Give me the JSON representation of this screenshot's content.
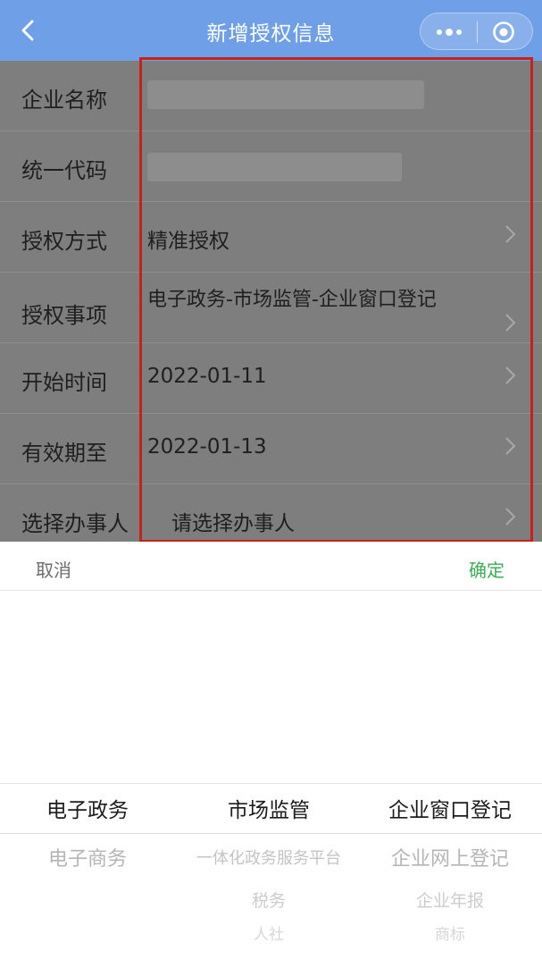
{
  "header": {
    "title": "新增授权信息",
    "back_icon": "chevron-left-icon",
    "more_icon": "more-dots-icon",
    "close_icon": "target-circle-icon"
  },
  "form": {
    "rows": [
      {
        "label": "企业名称",
        "value": ""
      },
      {
        "label": "统一代码",
        "value": ""
      },
      {
        "label": "授权方式",
        "value": "精准授权"
      },
      {
        "label": "授权事项",
        "value": "电子政务-市场监管-企业窗口登记"
      },
      {
        "label": "开始时间",
        "value": "2022-01-11"
      },
      {
        "label": "有效期至",
        "value": "2022-01-13"
      },
      {
        "label": "选择办事人",
        "value": "请选择办事人"
      }
    ]
  },
  "picker": {
    "cancel_label": "取消",
    "confirm_label": "确定",
    "columns": [
      {
        "selected": "电子政务",
        "below": [
          "电子商务"
        ]
      },
      {
        "selected": "市场监管",
        "below": [
          "一体化政务服务平台",
          "税务",
          "人社"
        ]
      },
      {
        "selected": "企业窗口登记",
        "below": [
          "企业网上登记",
          "企业年报",
          "商标"
        ]
      }
    ]
  },
  "colors": {
    "title_bar": "#6f9fe6",
    "overlay": "#7e7e7e",
    "highlight_border": "#c8201c",
    "confirm": "#3cad54"
  }
}
